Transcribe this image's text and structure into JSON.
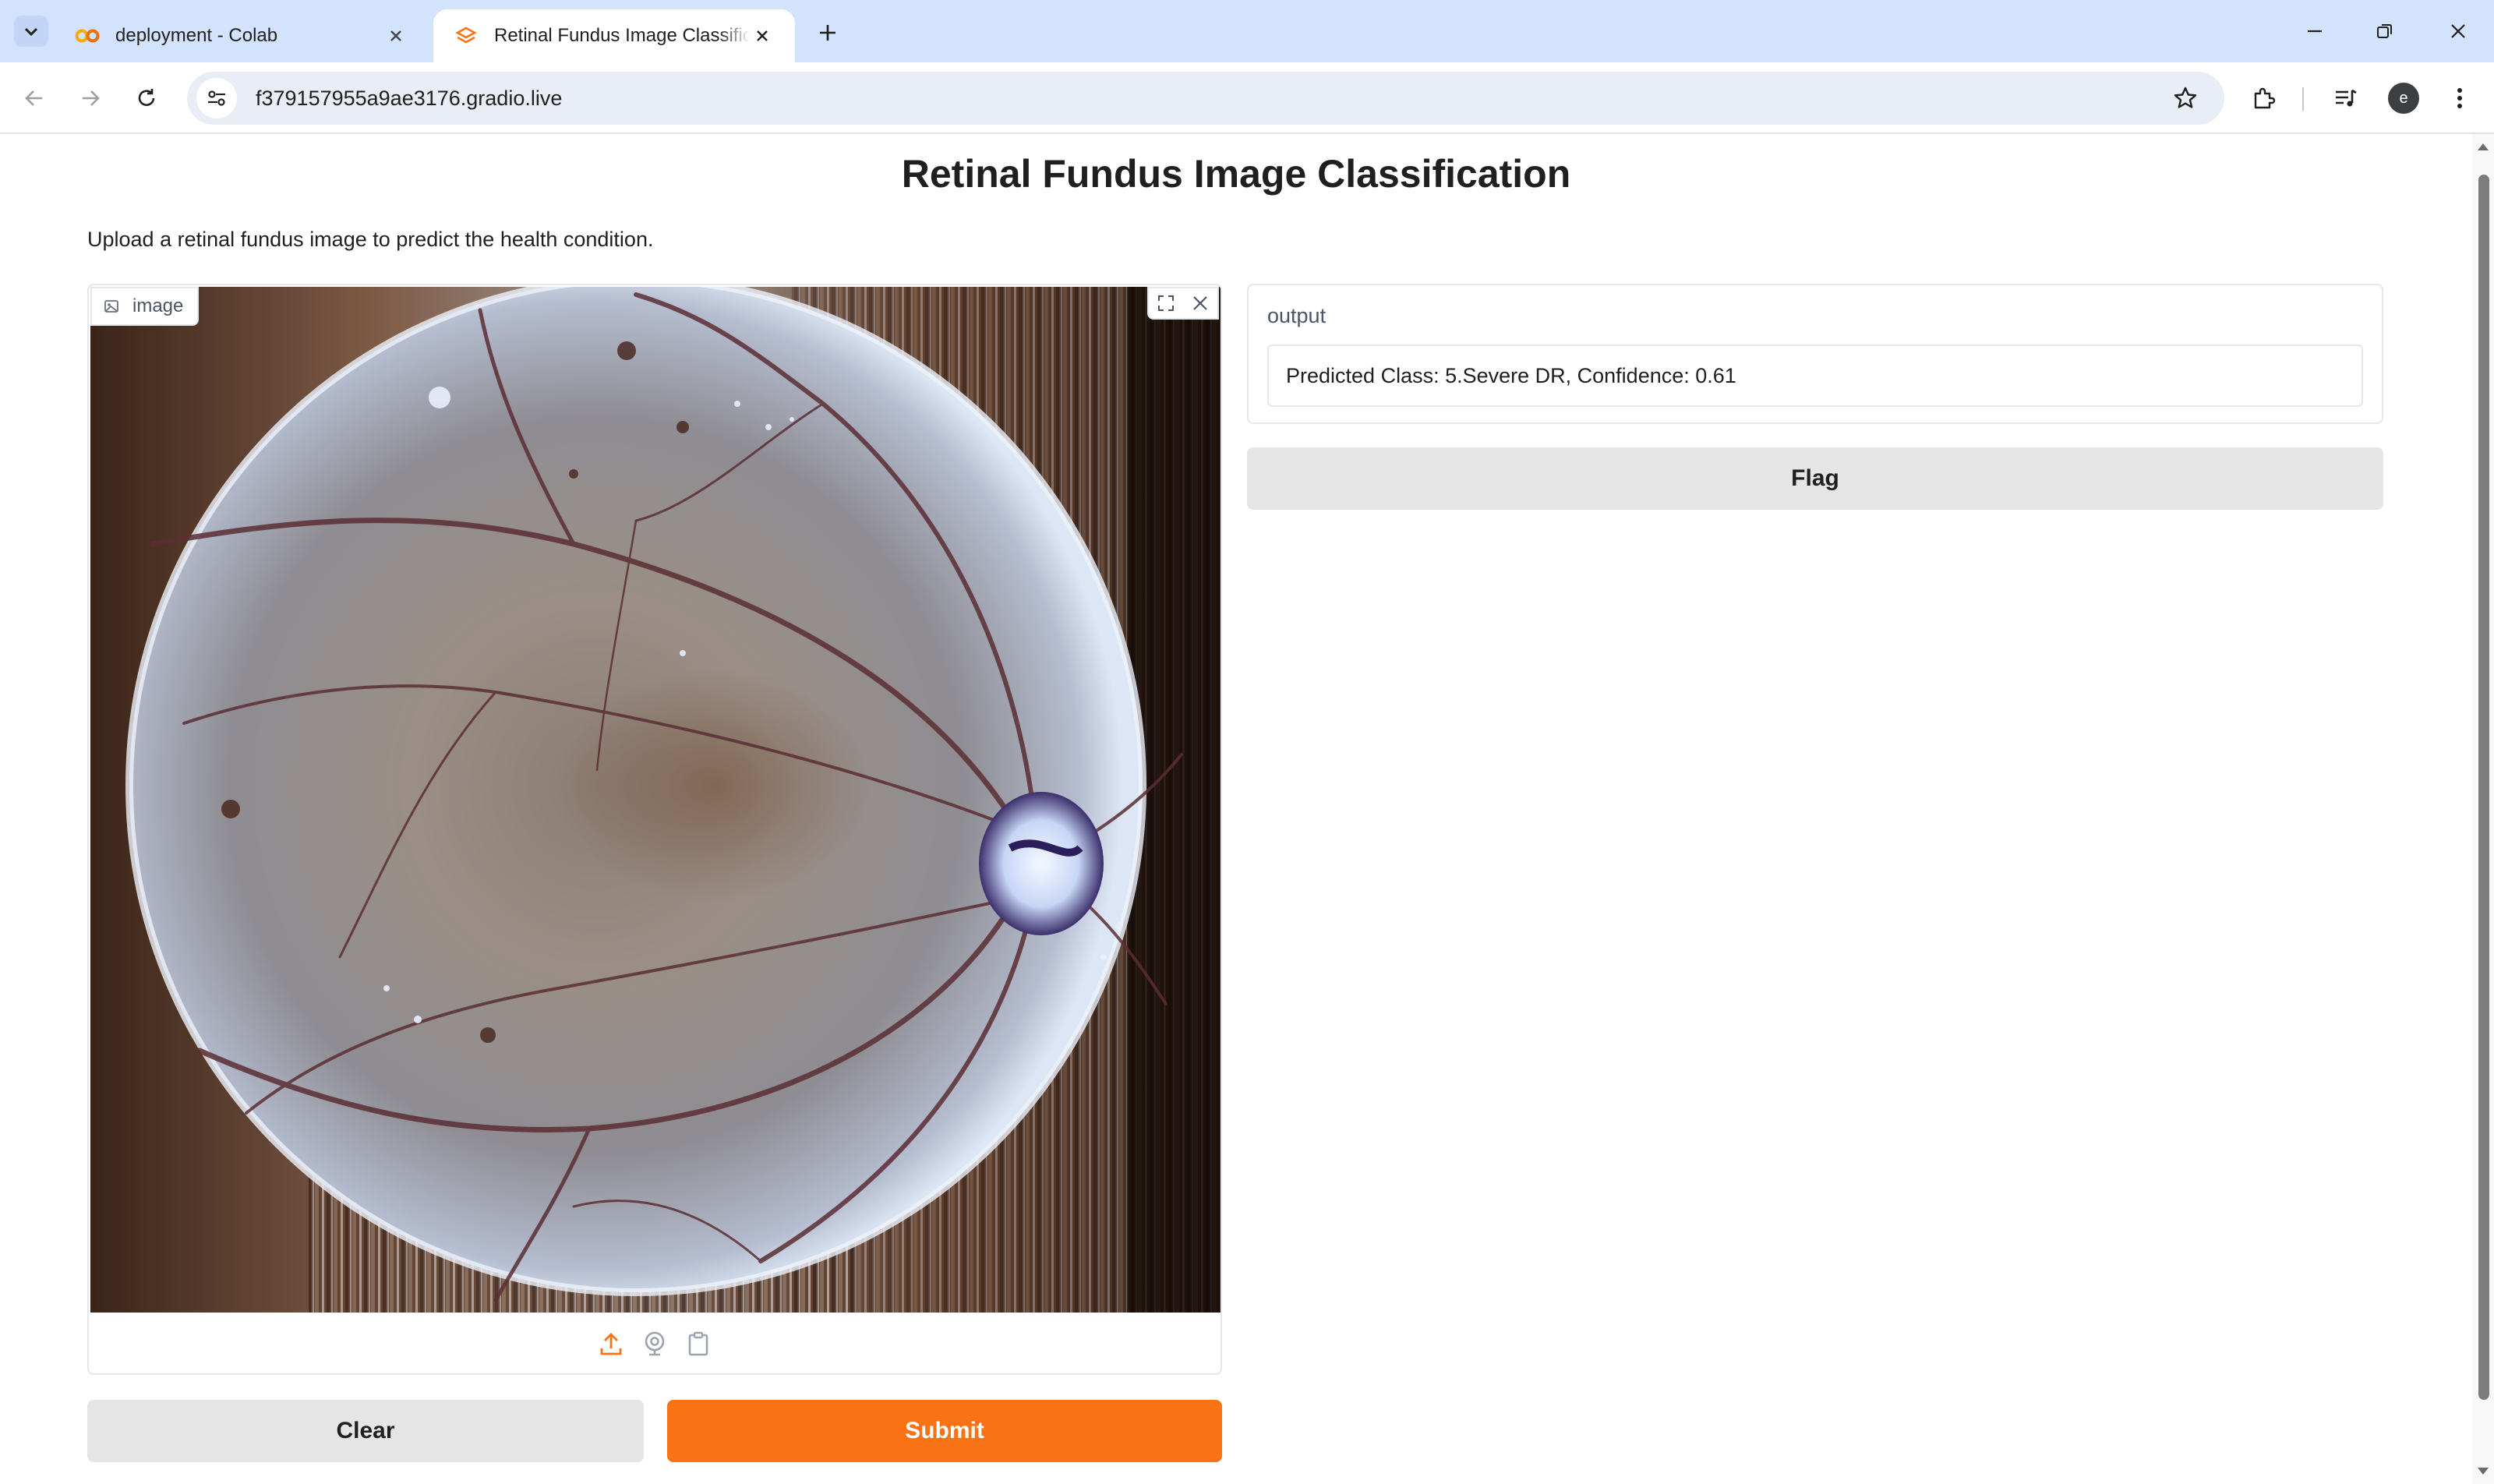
{
  "browser": {
    "tabs": [
      {
        "title": "deployment - Colab",
        "favicon": "colab-icon",
        "active": false
      },
      {
        "title": "Retinal Fundus Image Classification",
        "favicon": "gradio-icon",
        "active": true
      }
    ],
    "url": "f379157955a9ae3176.gradio.live",
    "profile_initial": "e"
  },
  "page": {
    "title": "Retinal Fundus Image Classification",
    "description": "Upload a retinal fundus image to predict the health condition.",
    "input": {
      "label": "image",
      "label_icon": "image-icon",
      "actions": [
        "fullscreen-icon",
        "close-icon"
      ],
      "sources": [
        "upload-icon",
        "webcam-icon",
        "clipboard-icon"
      ]
    },
    "output": {
      "label": "output",
      "value": "Predicted Class: 5.Severe DR, Confidence: 0.61"
    },
    "buttons": {
      "clear": "Clear",
      "submit": "Submit",
      "flag": "Flag"
    },
    "colors": {
      "accent": "#f97316",
      "secondary_button": "#e5e5e5",
      "tab_strip": "#d3e3fd"
    }
  }
}
